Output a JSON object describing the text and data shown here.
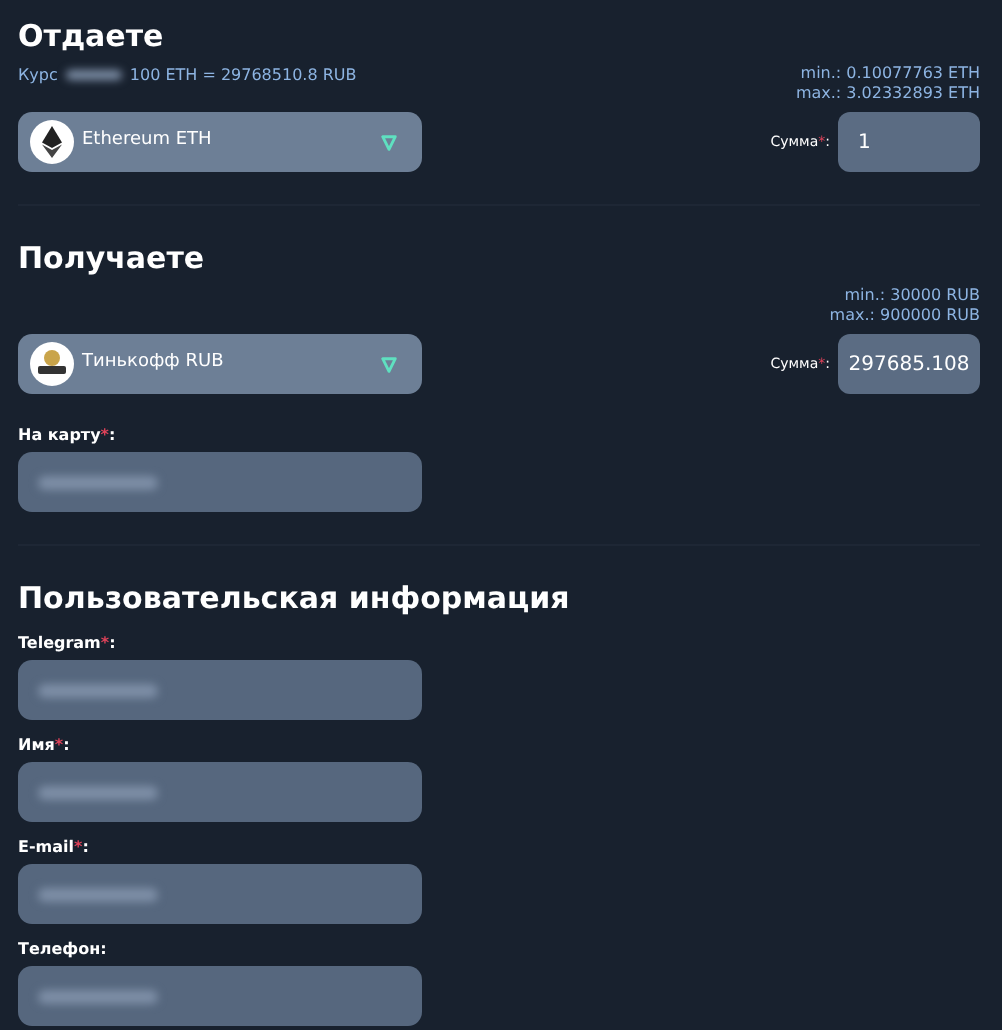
{
  "give": {
    "title": "Отдаете",
    "rate": {
      "label": "Курс",
      "redacted": true,
      "value": "100 ETH = 29768510.8 RUB"
    },
    "limits": [
      "min.: 0.10077763 ETH",
      "max.: 3.02332893 ETH"
    ],
    "currency": {
      "name": "Ethereum ETH",
      "kind": "eth"
    },
    "amount": {
      "label": "Сумма",
      "required_mark": "*",
      "suffix": ":",
      "value": "1"
    }
  },
  "receive": {
    "title": "Получаете",
    "limits": [
      "min.: 30000 RUB",
      "max.: 900000 RUB"
    ],
    "currency": {
      "name": "Тинькофф RUB",
      "kind": "bank"
    },
    "amount": {
      "label": "Сумма",
      "required_mark": "*",
      "suffix": ":",
      "value": "297685.108"
    },
    "fields": [
      {
        "label": "На карту",
        "required_mark": "*",
        "suffix": ":",
        "redacted": true
      }
    ]
  },
  "user_info": {
    "title": "Пользовательская информация",
    "fields": [
      {
        "label": "Telegram",
        "required_mark": "*",
        "suffix": ":",
        "redacted": true
      },
      {
        "label": "Имя",
        "required_mark": "*",
        "suffix": ":",
        "redacted": true
      },
      {
        "label": "E-mail",
        "required_mark": "*",
        "suffix": ":",
        "redacted": true
      },
      {
        "label": "Телефон",
        "suffix": ":",
        "redacted": true
      }
    ]
  }
}
